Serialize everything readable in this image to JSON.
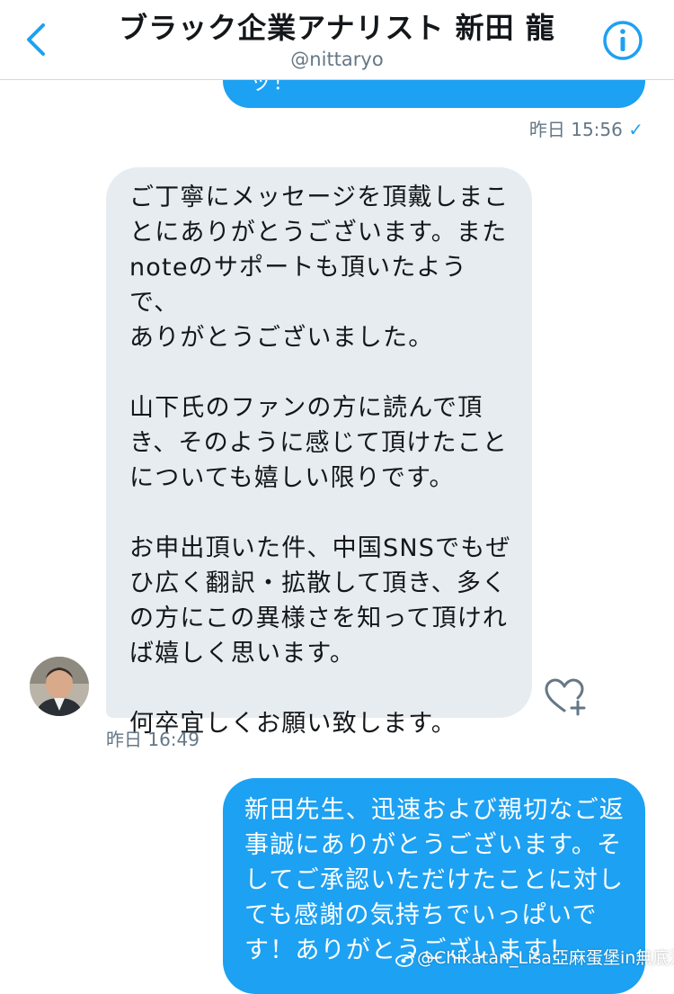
{
  "header": {
    "title": "ブラック企業アナリスト 新田 龍",
    "handle": "@nittaryo"
  },
  "icons": {
    "back": "chevron-left-icon",
    "info": "info-icon",
    "like": "heart-plus-icon",
    "read": "checkmark-icon"
  },
  "colors": {
    "accent": "#1da1f2",
    "incoming_bubble": "#e6ecf0",
    "meta_text": "#657786"
  },
  "messages": [
    {
      "direction": "outgoing",
      "text_fragment": "ッ！",
      "timestamp": "昨日 15:56",
      "read_mark": "✓"
    },
    {
      "direction": "incoming",
      "text": "ご丁寧にメッセージを頂戴しまこ\nとにありがとうございます。また\nnoteのサポートも頂いたようで、\nありがとうございました。\n\n山下氏のファンの方に読んで頂\nき、そのように感じて頂けたこと\nについても嬉しい限りです。\n\nお申出頂いた件、中国SNSでもぜ\nひ広く翻訳・拡散して頂き、多く\nの方にこの異様さを知って頂けれ\nば嬉しく思います。\n\n何卒宜しくお願い致します。",
      "timestamp": "昨日 16:49"
    },
    {
      "direction": "outgoing",
      "text": "新田先生、迅速および親切なご返\n事誠にありがとうございます。そ\nしてご承認いただけたことに対し\nても感謝の気持ちでいっぱいで\nす！ありがとうございます！"
    }
  ],
  "watermark": "@Chikatan_Lisa亞麻蛋堡in無底洞"
}
